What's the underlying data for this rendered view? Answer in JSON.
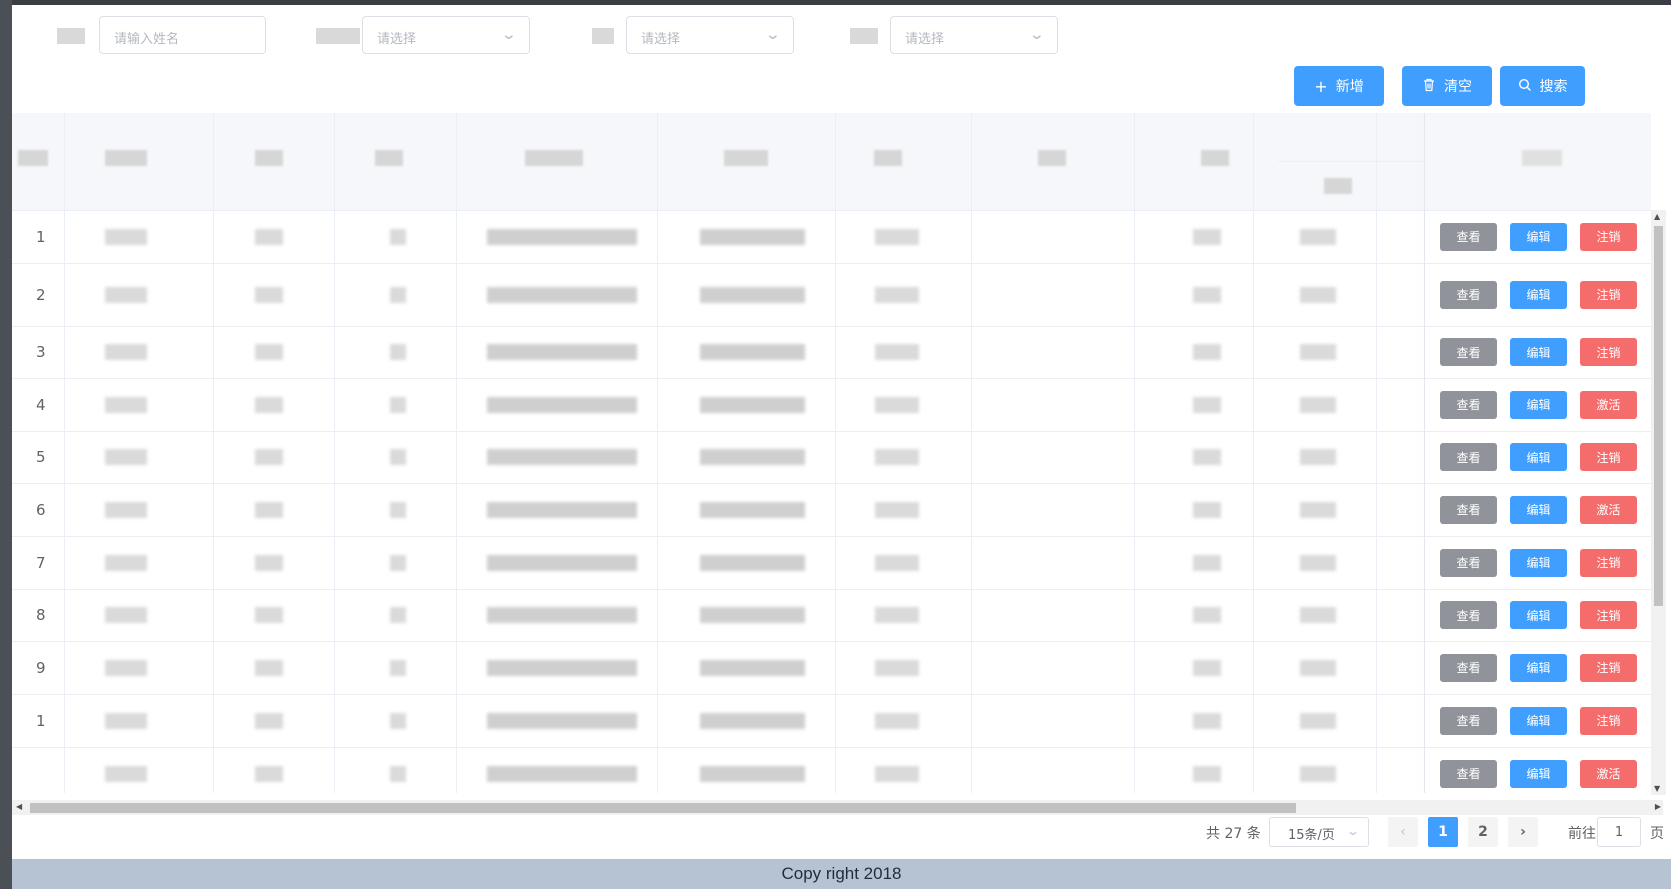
{
  "filters": {
    "name_placeholder": "请输入姓名",
    "select1_placeholder": "请选择",
    "select2_placeholder": "请选择",
    "select3_placeholder": "请选择"
  },
  "toolbar": {
    "add_label": "新增",
    "clear_label": "清空",
    "search_label": "搜索"
  },
  "table": {
    "rows": [
      {
        "index": "1",
        "status_action": "注销"
      },
      {
        "index": "2",
        "status_action": "注销"
      },
      {
        "index": "3",
        "status_action": "注销"
      },
      {
        "index": "4",
        "status_action": "激活"
      },
      {
        "index": "5",
        "status_action": "注销"
      },
      {
        "index": "6",
        "status_action": "激活"
      },
      {
        "index": "7",
        "status_action": "注销"
      },
      {
        "index": "8",
        "status_action": "注销"
      },
      {
        "index": "9",
        "status_action": "注销"
      },
      {
        "index": "1",
        "status_action": "注销"
      },
      {
        "index": "",
        "status_action": "激活"
      }
    ],
    "view_label": "查看",
    "edit_label": "编辑"
  },
  "pagination": {
    "total_text": "共 27 条",
    "page_size": "15条/页",
    "prev_icon": "chevron-left-icon",
    "next_icon": "chevron-right-icon",
    "pages": [
      "1",
      "2"
    ],
    "current_page": 1,
    "goto_label": "前往",
    "goto_value": "1",
    "page_suffix": "页"
  },
  "footer": {
    "copyright": "Copy right 2018"
  },
  "colors": {
    "primary": "#409eff",
    "danger": "#f56c6c",
    "info": "#909399",
    "footer_bg": "#b6c3d3"
  }
}
